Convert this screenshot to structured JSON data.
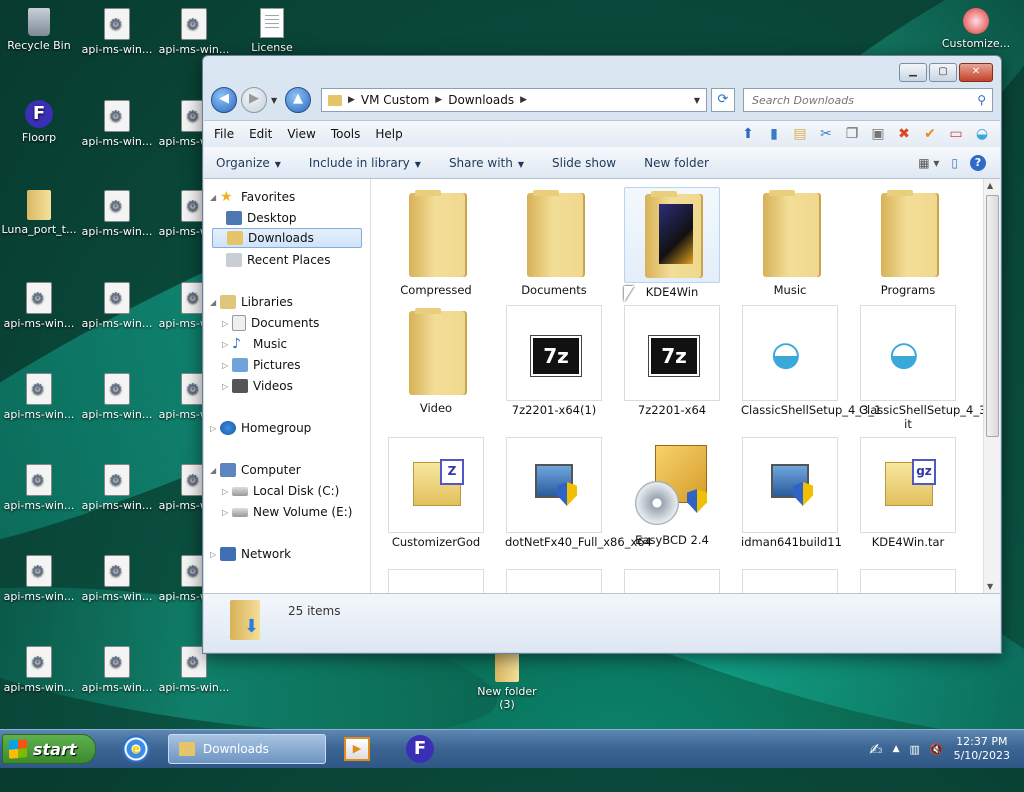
{
  "desktop": {
    "icons": [
      {
        "label": "Recycle Bin",
        "icon": "recycle-bin-icon"
      },
      {
        "label": "api-ms-win...",
        "icon": "dll-file-icon"
      },
      {
        "label": "api-ms-win...",
        "icon": "dll-file-icon"
      },
      {
        "label": "License",
        "icon": "text-file-icon"
      },
      {
        "label": "Customize...",
        "icon": "customize-icon"
      },
      {
        "label": "Floorp",
        "icon": "floorp-icon"
      },
      {
        "label": "api-ms-win...",
        "icon": "dll-file-icon"
      },
      {
        "label": "api-ms-win...",
        "icon": "dll-file-icon"
      },
      {
        "label": "Luna_port_t...",
        "icon": "folder-icon"
      },
      {
        "label": "api-ms-win...",
        "icon": "dll-file-icon"
      },
      {
        "label": "api-ms-win...",
        "icon": "dll-file-icon"
      },
      {
        "label": "api-ms-win...",
        "icon": "dll-file-icon"
      },
      {
        "label": "api-ms-win...",
        "icon": "dll-file-icon"
      },
      {
        "label": "api-ms-win...",
        "icon": "dll-file-icon"
      },
      {
        "label": "api-ms-win...",
        "icon": "dll-file-icon"
      },
      {
        "label": "api-ms-win...",
        "icon": "dll-file-icon"
      },
      {
        "label": "api-ms-win...",
        "icon": "dll-file-icon"
      },
      {
        "label": "api-ms-win...",
        "icon": "dll-file-icon"
      },
      {
        "label": "api-ms-win...",
        "icon": "dll-file-icon"
      },
      {
        "label": "api-ms-win...",
        "icon": "dll-file-icon"
      },
      {
        "label": "api-ms-win...",
        "icon": "dll-file-icon"
      },
      {
        "label": "api-ms-win...",
        "icon": "dll-file-icon"
      },
      {
        "label": "api-ms-win...",
        "icon": "dll-file-icon"
      },
      {
        "label": "api-ms-win...",
        "icon": "dll-file-icon"
      },
      {
        "label": "api-ms-win...",
        "icon": "dll-file-icon"
      },
      {
        "label": "api-ms-win...",
        "icon": "dll-file-icon"
      },
      {
        "label": "api-ms-win...",
        "icon": "dll-file-icon"
      },
      {
        "label": "New folder (3)",
        "icon": "folder-icon"
      }
    ]
  },
  "explorer": {
    "breadcrumb": [
      "VM Custom",
      "Downloads"
    ],
    "search_placeholder": "Search Downloads",
    "menu": [
      "File",
      "Edit",
      "View",
      "Tools",
      "Help"
    ],
    "commands": [
      "Organize",
      "Include in library",
      "Share with",
      "Slide show",
      "New folder"
    ],
    "nav": {
      "favorites": "Favorites",
      "desktop": "Desktop",
      "downloads": "Downloads",
      "recent": "Recent Places",
      "libraries": "Libraries",
      "documents": "Documents",
      "music": "Music",
      "pictures": "Pictures",
      "videos": "Videos",
      "homegroup": "Homegroup",
      "computer": "Computer",
      "local_disk": "Local Disk (C:)",
      "new_volume": "New Volume (E:)",
      "network": "Network"
    },
    "items": [
      {
        "name": "Compressed",
        "icon": "folder-icon"
      },
      {
        "name": "Documents",
        "icon": "folder-icon"
      },
      {
        "name": "KDE4Win",
        "icon": "folder-icon"
      },
      {
        "name": "Music",
        "icon": "folder-icon"
      },
      {
        "name": "Programs",
        "icon": "folder-icon"
      },
      {
        "name": "Video",
        "icon": "folder-icon"
      },
      {
        "name": "7z2201-x64(1)",
        "icon": "7zip-installer-icon"
      },
      {
        "name": "7z2201-x64",
        "icon": "7zip-installer-icon"
      },
      {
        "name": "ClassicShellSetup_4_3_1",
        "icon": "shell-setup-icon"
      },
      {
        "name": "ClassicShellSetup_4_3_1-it",
        "icon": "shell-setup-icon"
      },
      {
        "name": "CustomizerGod",
        "icon": "zip-archive-icon"
      },
      {
        "name": "dotNetFx40_Full_x86_x64",
        "icon": "installer-icon"
      },
      {
        "name": "EasyBCD 2.4",
        "icon": "easybcd-icon"
      },
      {
        "name": "idman641build11",
        "icon": "installer-icon"
      },
      {
        "name": "KDE4Win.tar",
        "icon": "zip-archive-icon"
      }
    ],
    "status": "25 items"
  },
  "taskbar": {
    "start_label": "start",
    "active_window": "Downloads",
    "time": "12:37 PM",
    "date": "5/10/2023"
  },
  "colors": {
    "accent": "#2f6bc6",
    "taskbar": "#3d6694",
    "start": "#3c8a2f"
  }
}
